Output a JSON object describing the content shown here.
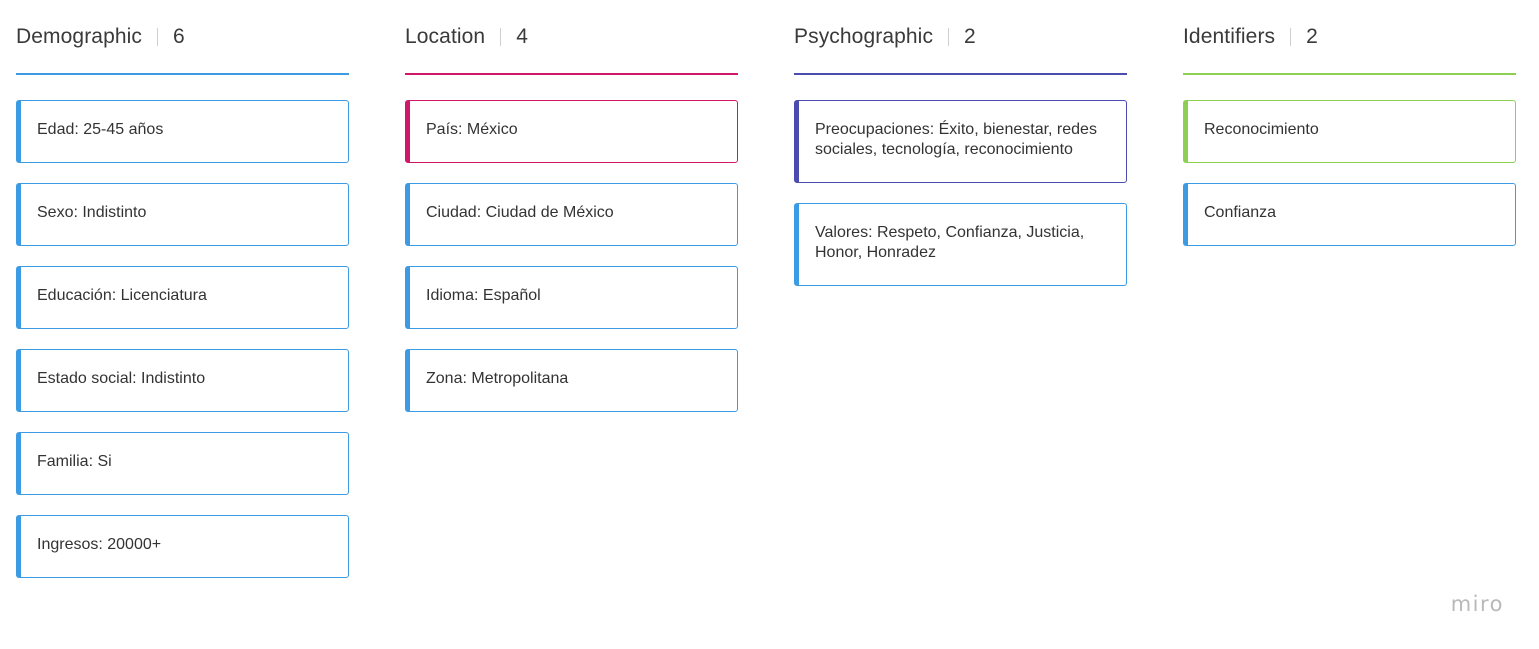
{
  "colors": {
    "blue": "#3d9be3",
    "pink": "#d0176a",
    "indigo": "#4a4cae",
    "green": "#8ccf52",
    "logo": "#b9b9b9"
  },
  "columns": [
    {
      "title": "Demographic",
      "count": "6",
      "rule_color": "#3d9be3",
      "cards": [
        {
          "text": "Edad: 25-45 años",
          "accent": "#3d9be3"
        },
        {
          "text": "Sexo: Indistinto",
          "accent": "#3d9be3"
        },
        {
          "text": "Educación: Licenciatura",
          "accent": "#3d9be3"
        },
        {
          "text": "Estado social: Indistinto",
          "accent": "#3d9be3"
        },
        {
          "text": "Familia: Si",
          "accent": "#3d9be3"
        },
        {
          "text": "Ingresos: 20000+",
          "accent": "#3d9be3"
        }
      ]
    },
    {
      "title": "Location",
      "count": "4",
      "rule_color": "#d0176a",
      "cards": [
        {
          "text": "País: México",
          "accent": "#d0176a"
        },
        {
          "text": "Ciudad: Ciudad de México",
          "accent": "#3d9be3"
        },
        {
          "text": "Idioma: Español",
          "accent": "#3d9be3"
        },
        {
          "text": "Zona: Metropolitana",
          "accent": "#3d9be3"
        }
      ]
    },
    {
      "title": "Psychographic",
      "count": "2",
      "rule_color": "#4a4cae",
      "cards": [
        {
          "text": "Preocupaciones: Éxito, bienestar, redes sociales, tecnología, reconocimiento",
          "accent": "#4a4cae"
        },
        {
          "text": "Valores: Respeto, Confianza, Justicia, Honor, Honradez",
          "accent": "#3d9be3"
        }
      ]
    },
    {
      "title": "Identifiers",
      "count": "2",
      "rule_color": "#8ccf52",
      "cards": [
        {
          "text": "Reconocimiento",
          "accent": "#8ccf52"
        },
        {
          "text": "Confianza",
          "accent": "#3d9be3"
        }
      ]
    }
  ],
  "logo": "miro"
}
